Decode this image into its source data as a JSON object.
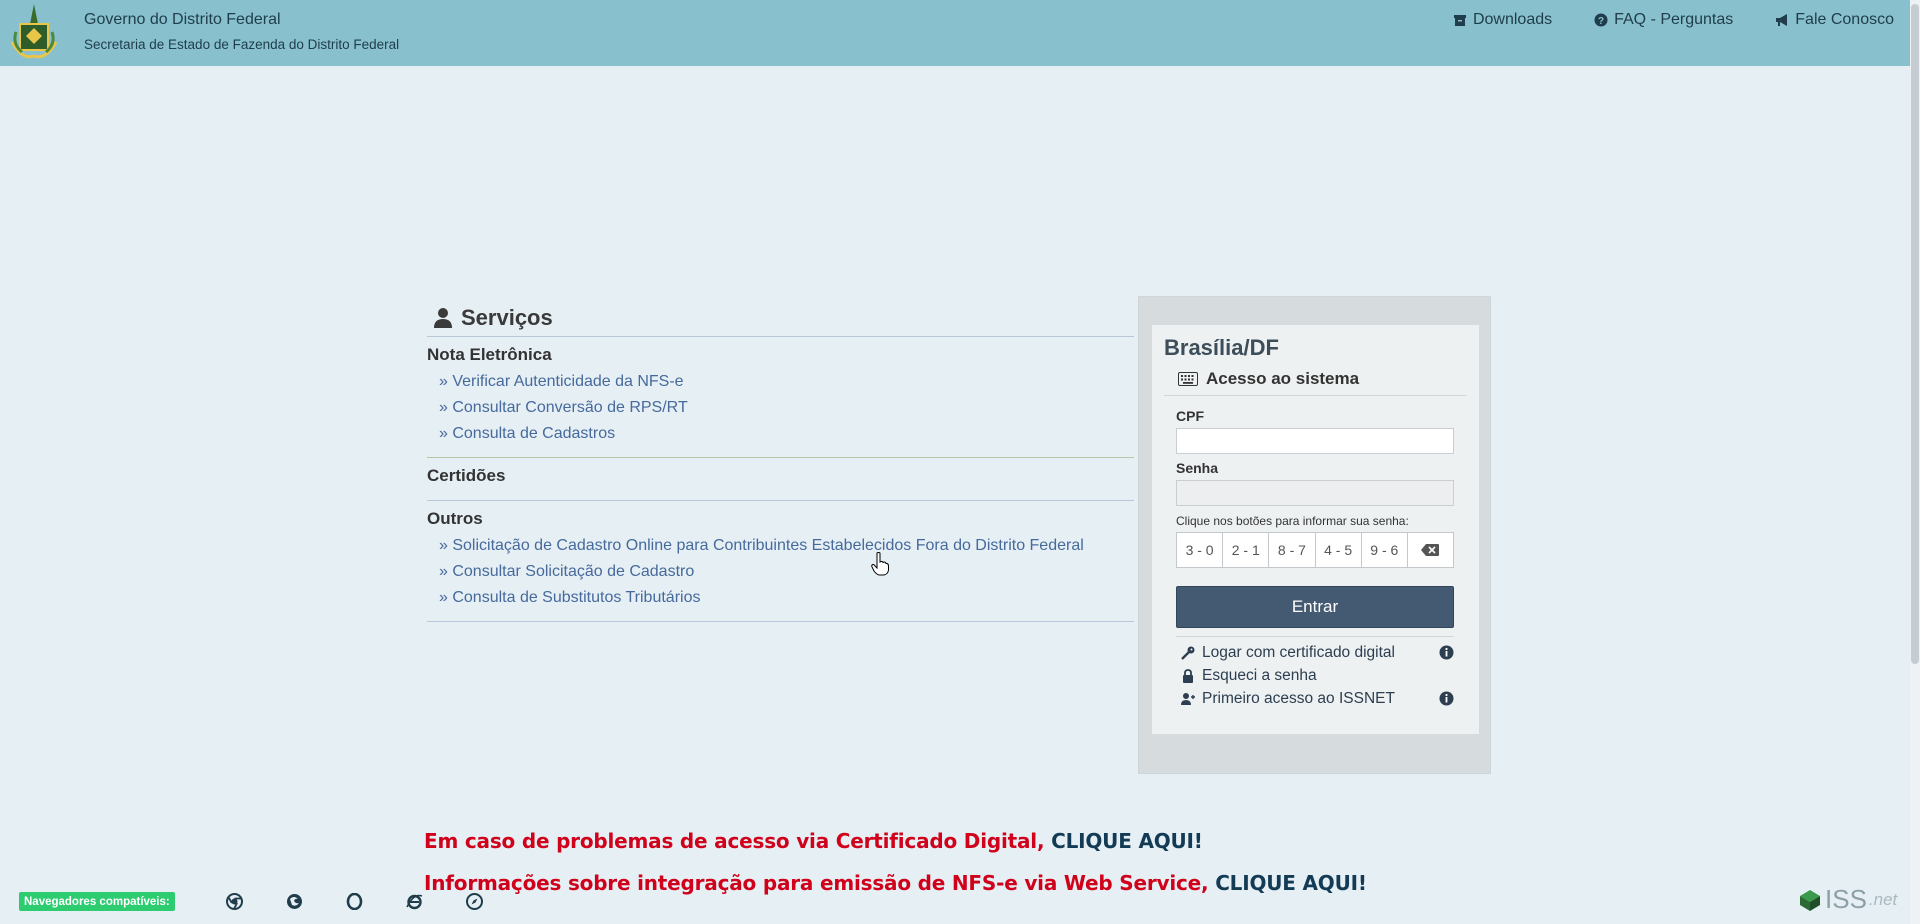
{
  "header": {
    "title": "Governo do Distrito Federal",
    "subtitle": "Secretaria de Estado de Fazenda do Distrito Federal",
    "links": {
      "downloads": "Downloads",
      "faq": "FAQ - Perguntas",
      "contact": "Fale Conosco"
    }
  },
  "services": {
    "title": "Serviços",
    "sections": {
      "nota": {
        "title": "Nota Eletrônica",
        "items": [
          "» Verificar Autenticidade da NFS-e",
          "» Consultar Conversão de RPS/RT",
          "» Consulta de Cadastros"
        ]
      },
      "certidoes": {
        "title": "Certidões"
      },
      "outros": {
        "title": "Outros",
        "items": [
          "» Solicitação de Cadastro Online para Contribuintes Estabelecidos Fora do Distrito Federal",
          "» Consultar Solicitação de Cadastro",
          "» Consulta de Substitutos Tributários"
        ]
      }
    }
  },
  "login": {
    "city": "Brasília/DF",
    "access_title": "Acesso ao sistema",
    "cpf_label": "CPF",
    "cpf_value": "",
    "password_label": "Senha",
    "password_value": "",
    "keypad_hint": "Clique nos botões para informar sua senha:",
    "keys": [
      "3 - 0",
      "2 - 1",
      "8 - 7",
      "4 - 5",
      "9 - 6"
    ],
    "enter_label": "Entrar",
    "options": {
      "certificate": "Logar com certificado digital",
      "forgot": "Esqueci a senha",
      "first_access": "Primeiro acesso ao ISSNET"
    }
  },
  "messages": {
    "cert_problem_text": "Em caso de problemas de acesso via Certificado Digital, ",
    "cert_problem_link": "CLIQUE AQUI!",
    "webservice_text": "Informações sobre integração para emissão de NFS-e via Web Service, ",
    "webservice_link": "CLIQUE AQUI!"
  },
  "footer": {
    "browsers_label": "Navegadores compatíveis:",
    "browsers": [
      "chrome-icon",
      "firefox-icon",
      "opera-icon",
      "ie-icon",
      "safari-icon"
    ],
    "brand_main": "ISS",
    "brand_suffix": ".net"
  },
  "colors": {
    "header_bg": "#88c0cd",
    "page_bg": "#e6eff4",
    "link": "#466a9c",
    "primary_button": "#445a73",
    "alert_red": "#d0021b",
    "badge_green": "#2ecc71"
  }
}
